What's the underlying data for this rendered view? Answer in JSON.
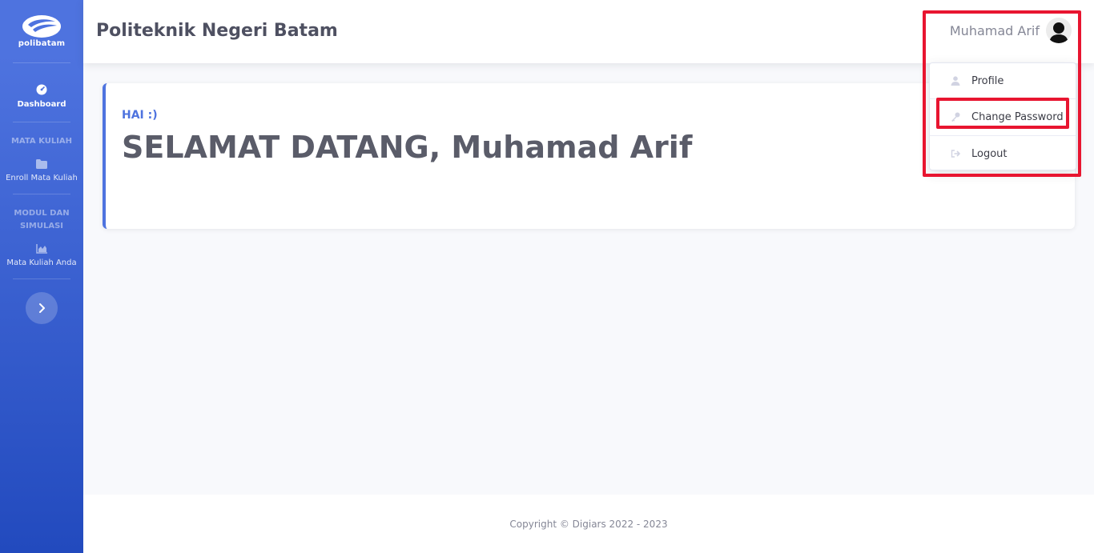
{
  "brand": {
    "name": "polibatam"
  },
  "sidebar": {
    "dashboard": {
      "label": "Dashboard",
      "icon": "tachometer-icon"
    },
    "heading_mata_kuliah": "MATA KULIAH",
    "enroll": {
      "label": "Enroll Mata Kuliah",
      "icon": "folder-icon"
    },
    "heading_modul": "MODUL DAN SIMULASI",
    "mata_kuliah_anda": {
      "label": "Mata Kuliah Anda",
      "icon": "chart-area-icon"
    },
    "toggle_icon": "chevron-right-icon"
  },
  "topbar": {
    "title": "Politeknik Negeri Batam",
    "user_name": "Muhamad Arif"
  },
  "user_menu": {
    "items": [
      {
        "label": "Profile",
        "icon": "user-icon"
      },
      {
        "label": "Change Password",
        "icon": "key-icon"
      },
      {
        "label": "Logout",
        "icon": "sign-out-icon"
      }
    ]
  },
  "welcome": {
    "greeting": "HAI :)",
    "headline": "SELAMAT DATANG, Muhamad Arif"
  },
  "footer": {
    "copyright": "Copyright © Digiars 2022 - 2023"
  },
  "colors": {
    "primary": "#4e73df",
    "primary_dark": "#224abe",
    "highlight": "#e81530",
    "text": "#5a5c69",
    "muted": "#858796"
  }
}
